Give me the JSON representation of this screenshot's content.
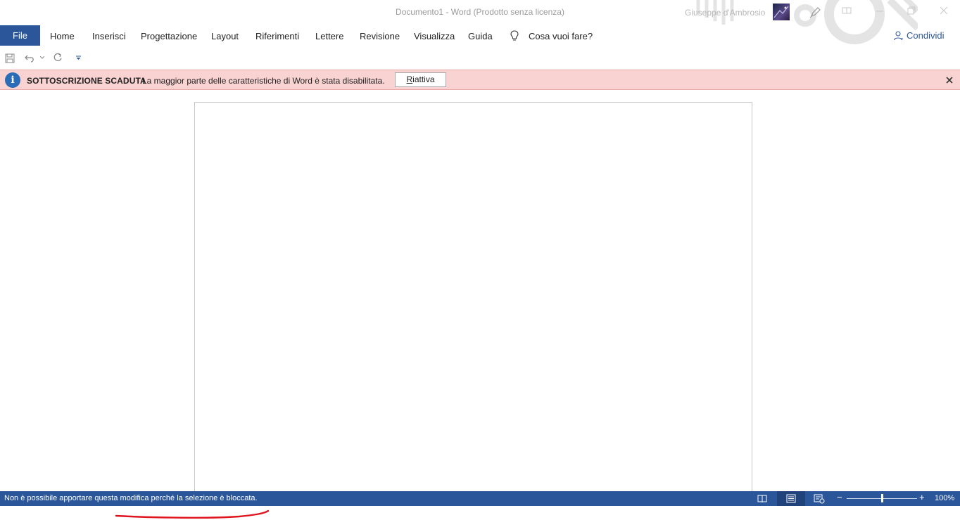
{
  "window": {
    "title": "Documento1  -  Word (Prodotto senza licenza)",
    "user_name": "Giuseppe d'Ambrosio"
  },
  "ribbon": {
    "file_label": "File",
    "tabs": [
      "Home",
      "Inserisci",
      "Progettazione",
      "Layout",
      "Riferimenti",
      "Lettere",
      "Revisione",
      "Visualizza",
      "Guida"
    ],
    "tell_me": "Cosa vuoi fare?",
    "share_label": "Condividi"
  },
  "message_bar": {
    "title": "SOTTOSCRIZIONE SCADUTA",
    "text": "La maggior parte delle caratteristiche di Word è stata disabilitata.",
    "button_first": "R",
    "button_rest": "iattiva"
  },
  "status_bar": {
    "message": "Non è possibile apportare questa modifica perché la selezione è bloccata.",
    "zoom_level": "100%",
    "zoom_fraction": 0.5
  },
  "colors": {
    "accent": "#2b579a",
    "message_bg": "#f9d2d2",
    "annotation": "#e0141e"
  }
}
